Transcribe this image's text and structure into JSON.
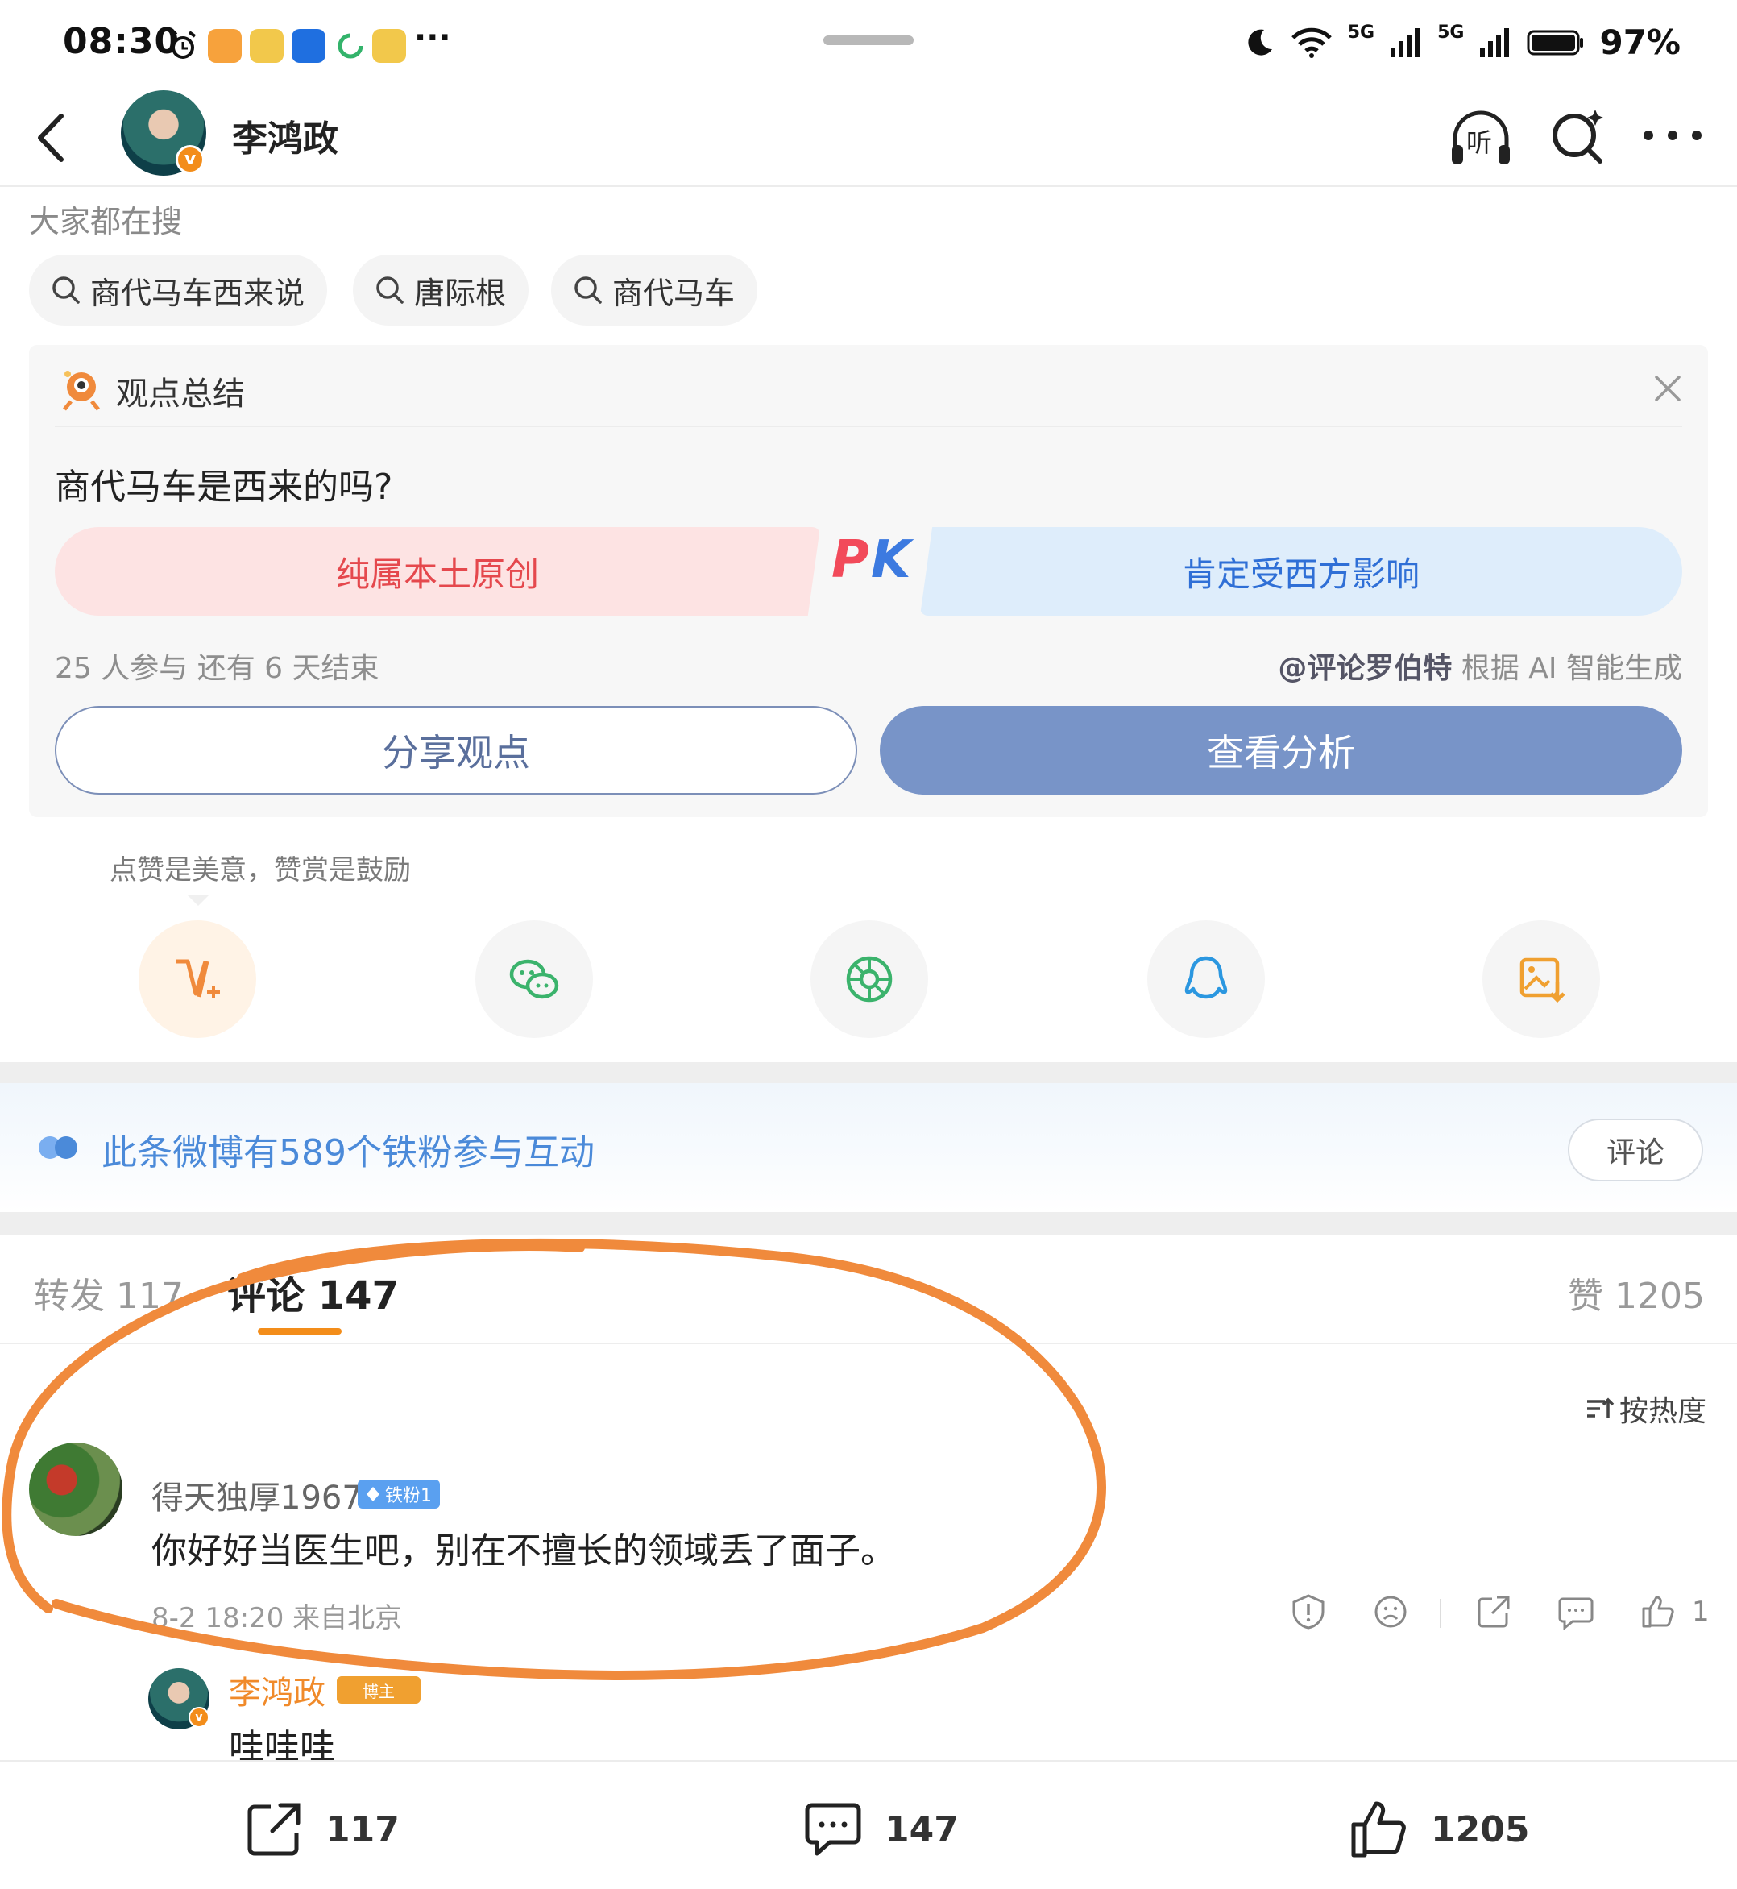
{
  "status_bar": {
    "time": "08:30",
    "more": "···",
    "network_1": "5G",
    "network_2": "5G",
    "battery": "97%"
  },
  "header": {
    "username": "李鸿政",
    "verified_badge": "v",
    "listen_label": "听"
  },
  "hot_search": {
    "label": "大家都在搜",
    "chips": [
      "商代马车西来说",
      "唐际根",
      "商代马车"
    ]
  },
  "opinion_card": {
    "title": "观点总结",
    "question": "商代马车是西来的吗?",
    "option_left": "纯属本土原创",
    "pk_label_p": "P",
    "pk_label_k": "K",
    "option_right": "肯定受西方影响",
    "meta": "25 人参与  还有 6 天结束",
    "source_user": "@评论罗伯特",
    "source_suffix": " 根据 AI 智能生成",
    "share_button": "分享观点",
    "analyze_button": "查看分析"
  },
  "reward": {
    "tip": "点赞是美意，赞赏是鼓励"
  },
  "share_targets": [
    "reward-icon",
    "wechat-icon",
    "moments-icon",
    "qq-icon",
    "save-image-icon"
  ],
  "fans_bar": {
    "text": "此条微博有589个铁粉参与互动",
    "comment_button": "评论"
  },
  "tabs": {
    "repost": "转发 117",
    "comment": "评论 147",
    "like": "赞 1205"
  },
  "sort": {
    "label": "按热度"
  },
  "comment": {
    "name": "得天独厚1967",
    "fan_badge": "铁粉1",
    "text": "你好好当医生吧，别在不擅长的领域丢了面子。",
    "meta": "8-2 18:20  来自北京",
    "like_count": "1"
  },
  "reply": {
    "name": "李鸿政",
    "badge": "博主",
    "text": "哇哇哇"
  },
  "bottom_bar": {
    "repost_count": "117",
    "comment_count": "147",
    "like_count": "1205"
  },
  "colors": {
    "accent_orange": "#f38d1a",
    "annotation_orange": "#f08a3c",
    "pk_red": "#e5484d",
    "pk_blue": "#2f6fd6",
    "analyze_blue": "#7894c8",
    "fans_blue": "#4b8ad9"
  }
}
